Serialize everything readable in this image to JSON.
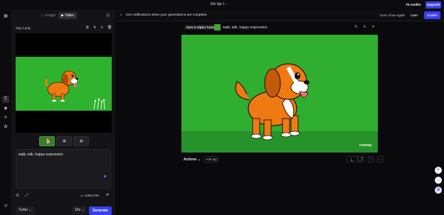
{
  "topbar": {
    "title": "Bài tập 1 ⋯",
    "credits": "75 credits",
    "upgrade": "Upgrade"
  },
  "rail": {
    "icons": [
      "grid-icon",
      "text-icon",
      "image-icon",
      "tools-icon",
      "settings-icon",
      "history-icon"
    ]
  },
  "left": {
    "modes": [
      "Image",
      "Video"
    ],
    "active_mode": "Video",
    "filename": "dog 1.png",
    "prompt": "walk, talk, happy expression",
    "resolution": "1280x768",
    "model": "Turbo",
    "duration": "10s",
    "generate": "Generate"
  },
  "notification": {
    "text": "Get notifications when your generations are complete.",
    "dont_show": "Don't show again",
    "later": "Later",
    "enable": "Enable"
  },
  "output": {
    "model_tag": "Gen-3 Alpha Turbo",
    "prompt": "walk, talk, happy expression",
    "watermark": "runway",
    "actions": "Actions",
    "add_tag": "Add tag"
  },
  "colors": {
    "accent": "#3b3ff0",
    "green_bg": "#2fb32e",
    "dog_orange": "#f07a12"
  }
}
